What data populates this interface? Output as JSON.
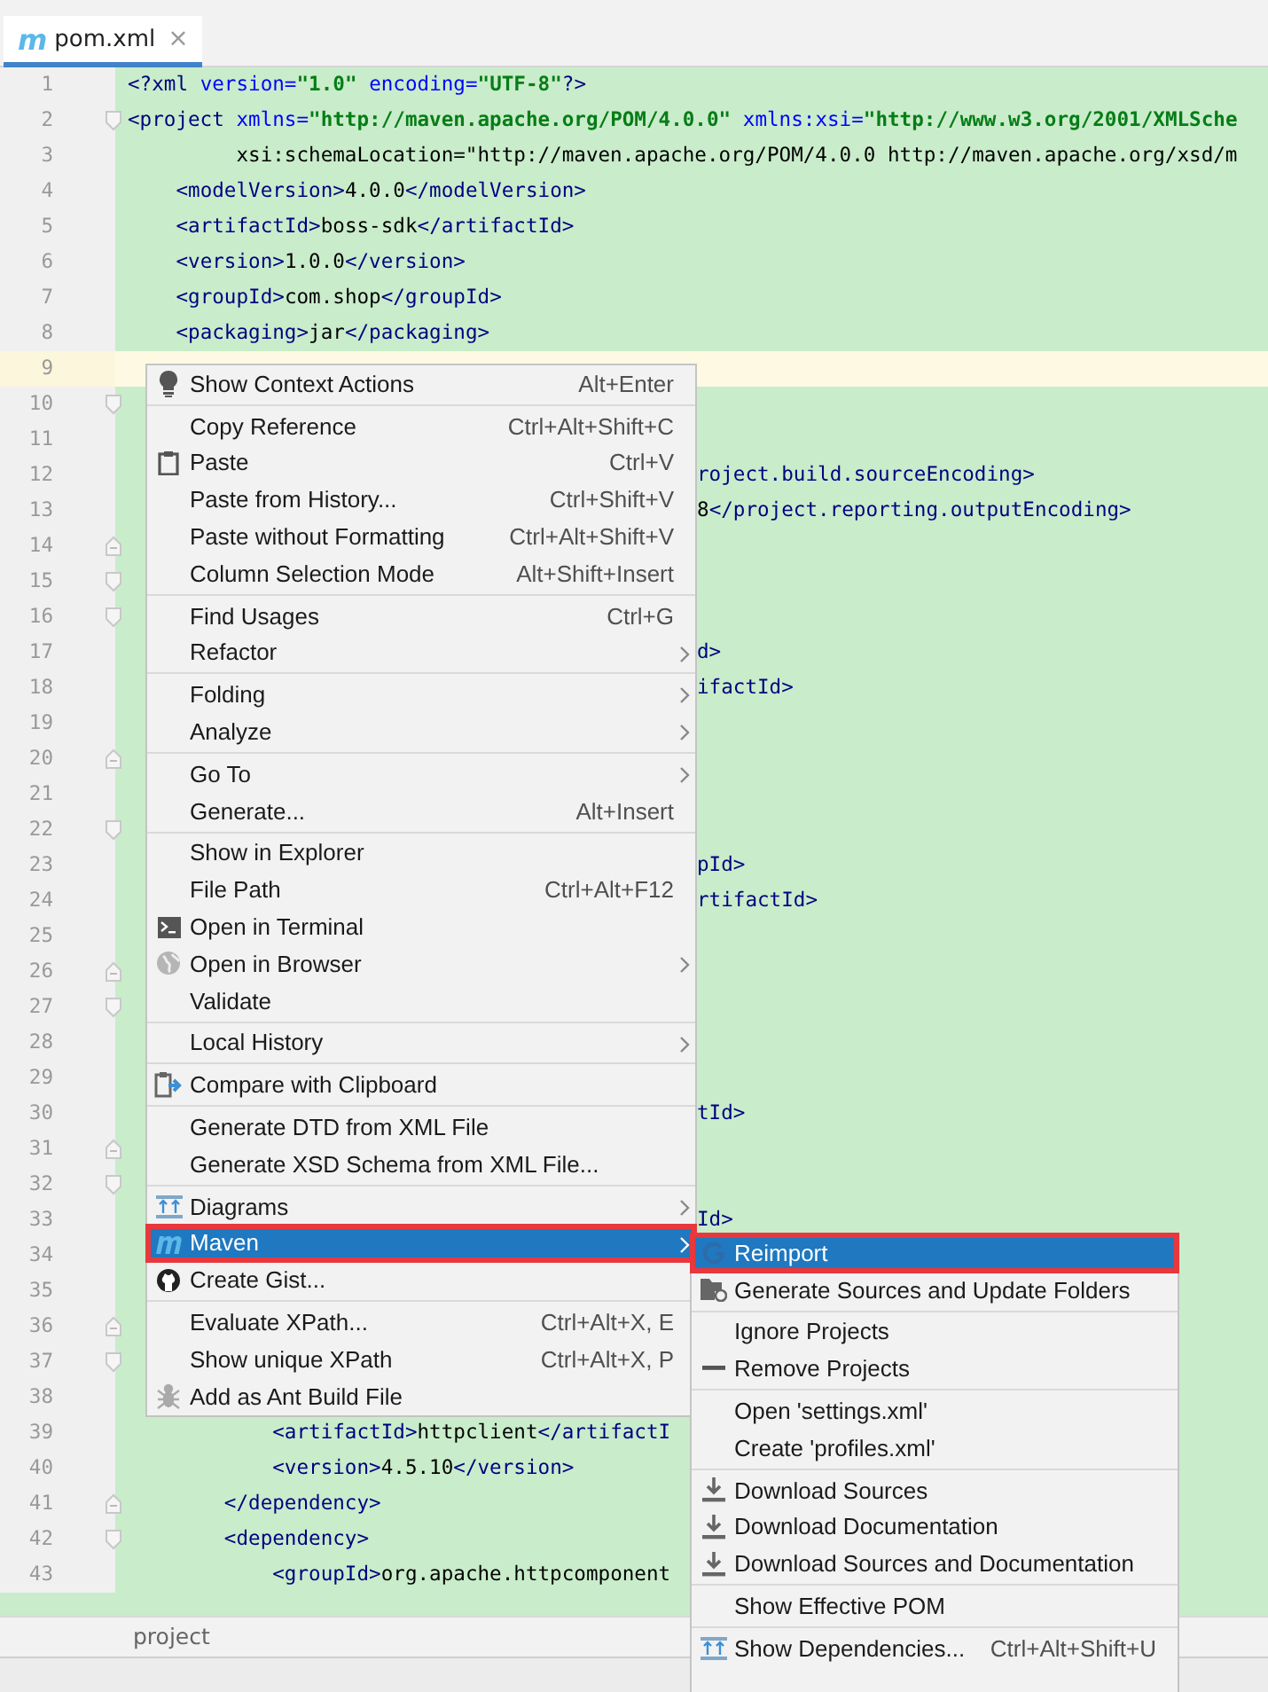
{
  "tab": {
    "icon_text": "m",
    "title": "pom.xml",
    "close": "×",
    "selected": true
  },
  "editor": {
    "lines": [
      {
        "number": "1",
        "text": "<?xml version=\"1.0\" encoding=\"UTF-8\"?>",
        "kind": "full",
        "current": false
      },
      {
        "number": "2",
        "text": "<project xmlns=\"http://maven.apache.org/POM/4.0.0\" xmlns:xsi=\"http://www.w3.org/2001/XMLSche",
        "kind": "full",
        "fold": {
          "kind": "start"
        },
        "current": false
      },
      {
        "number": "3",
        "text": "         xsi:schemaLocation=\"http://maven.apache.org/POM/4.0.0 http://maven.apache.org/xsd/m",
        "kind": "full",
        "current": false
      },
      {
        "number": "4",
        "text": "    <modelVersion>4.0.0</modelVersion>",
        "kind": "full",
        "current": false
      },
      {
        "number": "5",
        "text": "    <artifactId>boss-sdk</artifactId>",
        "kind": "full",
        "current": false
      },
      {
        "number": "6",
        "text": "    <version>1.0.0</version>",
        "kind": "full",
        "current": false
      },
      {
        "number": "7",
        "text": "    <groupId>com.shop</groupId>",
        "kind": "full",
        "current": false
      },
      {
        "number": "8",
        "text": "    <packaging>jar</packaging>",
        "kind": "full",
        "current": false
      },
      {
        "number": "9",
        "kind": "full",
        "current": true
      },
      {
        "number": "10",
        "kind": "full",
        "fold": {
          "kind": "start"
        },
        "current": false
      },
      {
        "number": "11",
        "kind": "full",
        "current": false
      },
      {
        "number": "12",
        "text": "roject.build.sourceEncoding>",
        "kind": "fragment",
        "current": false
      },
      {
        "number": "13",
        "text": "8</project.reporting.outputEncoding>",
        "kind": "fragment",
        "current": false
      },
      {
        "number": "14",
        "kind": "full",
        "fold": {
          "kind": "end"
        },
        "current": false
      },
      {
        "number": "15",
        "kind": "full",
        "fold": {
          "kind": "start"
        },
        "current": false
      },
      {
        "number": "16",
        "kind": "full",
        "fold": {
          "kind": "start"
        },
        "current": false
      },
      {
        "number": "17",
        "text": "d>",
        "kind": "fragment",
        "current": false
      },
      {
        "number": "18",
        "text": "ifactId>",
        "kind": "fragment",
        "current": false
      },
      {
        "number": "19",
        "kind": "full",
        "current": false
      },
      {
        "number": "20",
        "kind": "full",
        "fold": {
          "kind": "end"
        },
        "current": false
      },
      {
        "number": "21",
        "kind": "full",
        "current": false
      },
      {
        "number": "22",
        "kind": "full",
        "fold": {
          "kind": "start"
        },
        "current": false
      },
      {
        "number": "23",
        "text": "pId>",
        "kind": "fragment",
        "current": false
      },
      {
        "number": "24",
        "text": "rtifactId>",
        "kind": "fragment",
        "current": false
      },
      {
        "number": "25",
        "kind": "full",
        "current": false
      },
      {
        "number": "26",
        "kind": "full",
        "fold": {
          "kind": "end"
        },
        "current": false
      },
      {
        "number": "27",
        "kind": "full",
        "fold": {
          "kind": "start"
        },
        "current": false
      },
      {
        "number": "28",
        "kind": "full",
        "current": false
      },
      {
        "number": "29",
        "kind": "full",
        "current": false
      },
      {
        "number": "30",
        "text": "tId>",
        "kind": "fragment",
        "current": false
      },
      {
        "number": "31",
        "kind": "full",
        "fold": {
          "kind": "end"
        },
        "current": false
      },
      {
        "number": "32",
        "kind": "full",
        "fold": {
          "kind": "start"
        },
        "current": false
      },
      {
        "number": "33",
        "text": "Id>",
        "kind": "fragment",
        "current": false
      },
      {
        "number": "34",
        "kind": "full",
        "current": false
      },
      {
        "number": "35",
        "kind": "full",
        "current": false
      },
      {
        "number": "36",
        "kind": "full",
        "fold": {
          "kind": "end"
        },
        "current": false
      },
      {
        "number": "37",
        "kind": "full",
        "fold": {
          "kind": "start"
        },
        "current": false
      },
      {
        "number": "38",
        "kind": "full",
        "current": false
      },
      {
        "number": "39",
        "text": "            <artifactId>httpclient</artifactI",
        "kind": "full",
        "current": false
      },
      {
        "number": "40",
        "text": "            <version>4.5.10</version>",
        "kind": "full",
        "current": false
      },
      {
        "number": "41",
        "text": "        </dependency>",
        "kind": "full",
        "fold": {
          "kind": "end"
        },
        "current": false
      },
      {
        "number": "42",
        "text": "        <dependency>",
        "kind": "full",
        "fold": {
          "kind": "start"
        },
        "current": false
      },
      {
        "number": "43",
        "text": "            <groupId>org.apache.httpcomponent",
        "kind": "full",
        "current": false
      }
    ]
  },
  "breadcrumb": "project",
  "context_menu": {
    "groups": [
      {
        "items": [
          {
            "kind": "bulb",
            "label": "Show Context Actions",
            "shortcut": "Alt+Enter",
            "submenu": false,
            "selected": false,
            "outlined": false
          }
        ]
      },
      {
        "items": [
          {
            "label": "Copy Reference",
            "shortcut": "Ctrl+Alt+Shift+C",
            "submenu": false,
            "selected": false,
            "outlined": false
          },
          {
            "kind": "clipboard",
            "label": "Paste",
            "shortcut": "Ctrl+V",
            "submenu": false,
            "selected": false,
            "outlined": false
          },
          {
            "label": "Paste from History...",
            "shortcut": "Ctrl+Shift+V",
            "submenu": false,
            "selected": false,
            "outlined": false
          },
          {
            "label": "Paste without Formatting",
            "shortcut": "Ctrl+Alt+Shift+V",
            "submenu": false,
            "selected": false,
            "outlined": false
          },
          {
            "label": "Column Selection Mode",
            "shortcut": "Alt+Shift+Insert",
            "submenu": false,
            "selected": false,
            "outlined": false
          }
        ]
      },
      {
        "items": [
          {
            "label": "Find Usages",
            "shortcut": "Ctrl+G",
            "submenu": false,
            "selected": false,
            "outlined": false
          },
          {
            "label": "Refactor",
            "submenu": true,
            "selected": false,
            "outlined": false
          }
        ]
      },
      {
        "items": [
          {
            "label": "Folding",
            "submenu": true,
            "selected": false,
            "outlined": false
          },
          {
            "label": "Analyze",
            "submenu": true,
            "selected": false,
            "outlined": false
          }
        ]
      },
      {
        "items": [
          {
            "label": "Go To",
            "submenu": true,
            "selected": false,
            "outlined": false
          },
          {
            "label": "Generate...",
            "shortcut": "Alt+Insert",
            "submenu": false,
            "selected": false,
            "outlined": false
          }
        ]
      },
      {
        "items": [
          {
            "label": "Show in Explorer",
            "submenu": false,
            "selected": false,
            "outlined": false
          },
          {
            "label": "File Path",
            "shortcut": "Ctrl+Alt+F12",
            "submenu": false,
            "selected": false,
            "outlined": false
          },
          {
            "kind": "terminal",
            "label": "Open in Terminal",
            "submenu": false,
            "selected": false,
            "outlined": false
          },
          {
            "kind": "globe",
            "label": "Open in Browser",
            "submenu": true,
            "selected": false,
            "outlined": false
          },
          {
            "label": "Validate",
            "submenu": false,
            "selected": false,
            "outlined": false
          }
        ]
      },
      {
        "items": [
          {
            "label": "Local History",
            "submenu": true,
            "selected": false,
            "outlined": false
          }
        ]
      },
      {
        "items": [
          {
            "kind": "compare",
            "label": "Compare with Clipboard",
            "submenu": false,
            "selected": false,
            "outlined": false
          }
        ]
      },
      {
        "items": [
          {
            "label": "Generate DTD from XML File",
            "submenu": false,
            "selected": false,
            "outlined": false
          },
          {
            "label": "Generate XSD Schema from XML File...",
            "submenu": false,
            "selected": false,
            "outlined": false
          }
        ]
      },
      {
        "items": [
          {
            "kind": "diagram",
            "label": "Diagrams",
            "submenu": true,
            "selected": false,
            "outlined": false
          },
          {
            "kind": "maven",
            "label": "Maven",
            "submenu": true,
            "selected": true,
            "outlined": true
          },
          {
            "kind": "github",
            "label": "Create Gist...",
            "submenu": false,
            "selected": false,
            "outlined": false
          }
        ]
      },
      {
        "items": [
          {
            "label": "Evaluate XPath...",
            "shortcut": "Ctrl+Alt+X, E",
            "submenu": false,
            "selected": false,
            "outlined": false
          },
          {
            "label": "Show unique XPath",
            "shortcut": "Ctrl+Alt+X, P",
            "submenu": false,
            "selected": false,
            "outlined": false
          },
          {
            "kind": "ant",
            "label": "Add as Ant Build File",
            "submenu": false,
            "selected": false,
            "outlined": false
          }
        ]
      }
    ]
  },
  "maven_submenu": {
    "groups": [
      {
        "items": [
          {
            "kind": "refresh",
            "label": "Reimport",
            "submenu": false,
            "selected": true,
            "outlined": true
          },
          {
            "kind": "folder",
            "label": "Generate Sources and Update Folders",
            "submenu": false,
            "selected": false,
            "outlined": false
          }
        ]
      },
      {
        "items": [
          {
            "label": "Ignore Projects",
            "submenu": false,
            "selected": false,
            "outlined": false
          },
          {
            "kind": "minus",
            "label": "Remove Projects",
            "submenu": false,
            "selected": false,
            "outlined": false
          }
        ]
      },
      {
        "items": [
          {
            "label": "Open 'settings.xml'",
            "submenu": false,
            "selected": false,
            "outlined": false
          },
          {
            "label": "Create 'profiles.xml'",
            "submenu": false,
            "selected": false,
            "outlined": false
          }
        ]
      },
      {
        "items": [
          {
            "kind": "download",
            "label": "Download Sources",
            "submenu": false,
            "selected": false,
            "outlined": false
          },
          {
            "kind": "download",
            "label": "Download Documentation",
            "submenu": false,
            "selected": false,
            "outlined": false
          },
          {
            "kind": "download",
            "label": "Download Sources and Documentation",
            "submenu": false,
            "selected": false,
            "outlined": false
          }
        ]
      },
      {
        "items": [
          {
            "label": "Show Effective POM",
            "submenu": false,
            "selected": false,
            "outlined": false
          }
        ]
      },
      {
        "items": [
          {
            "kind": "diagram",
            "label": "Show Dependencies...",
            "shortcut": "Ctrl+Alt+Shift+U",
            "submenu": false,
            "selected": false,
            "outlined": false
          }
        ]
      }
    ]
  }
}
